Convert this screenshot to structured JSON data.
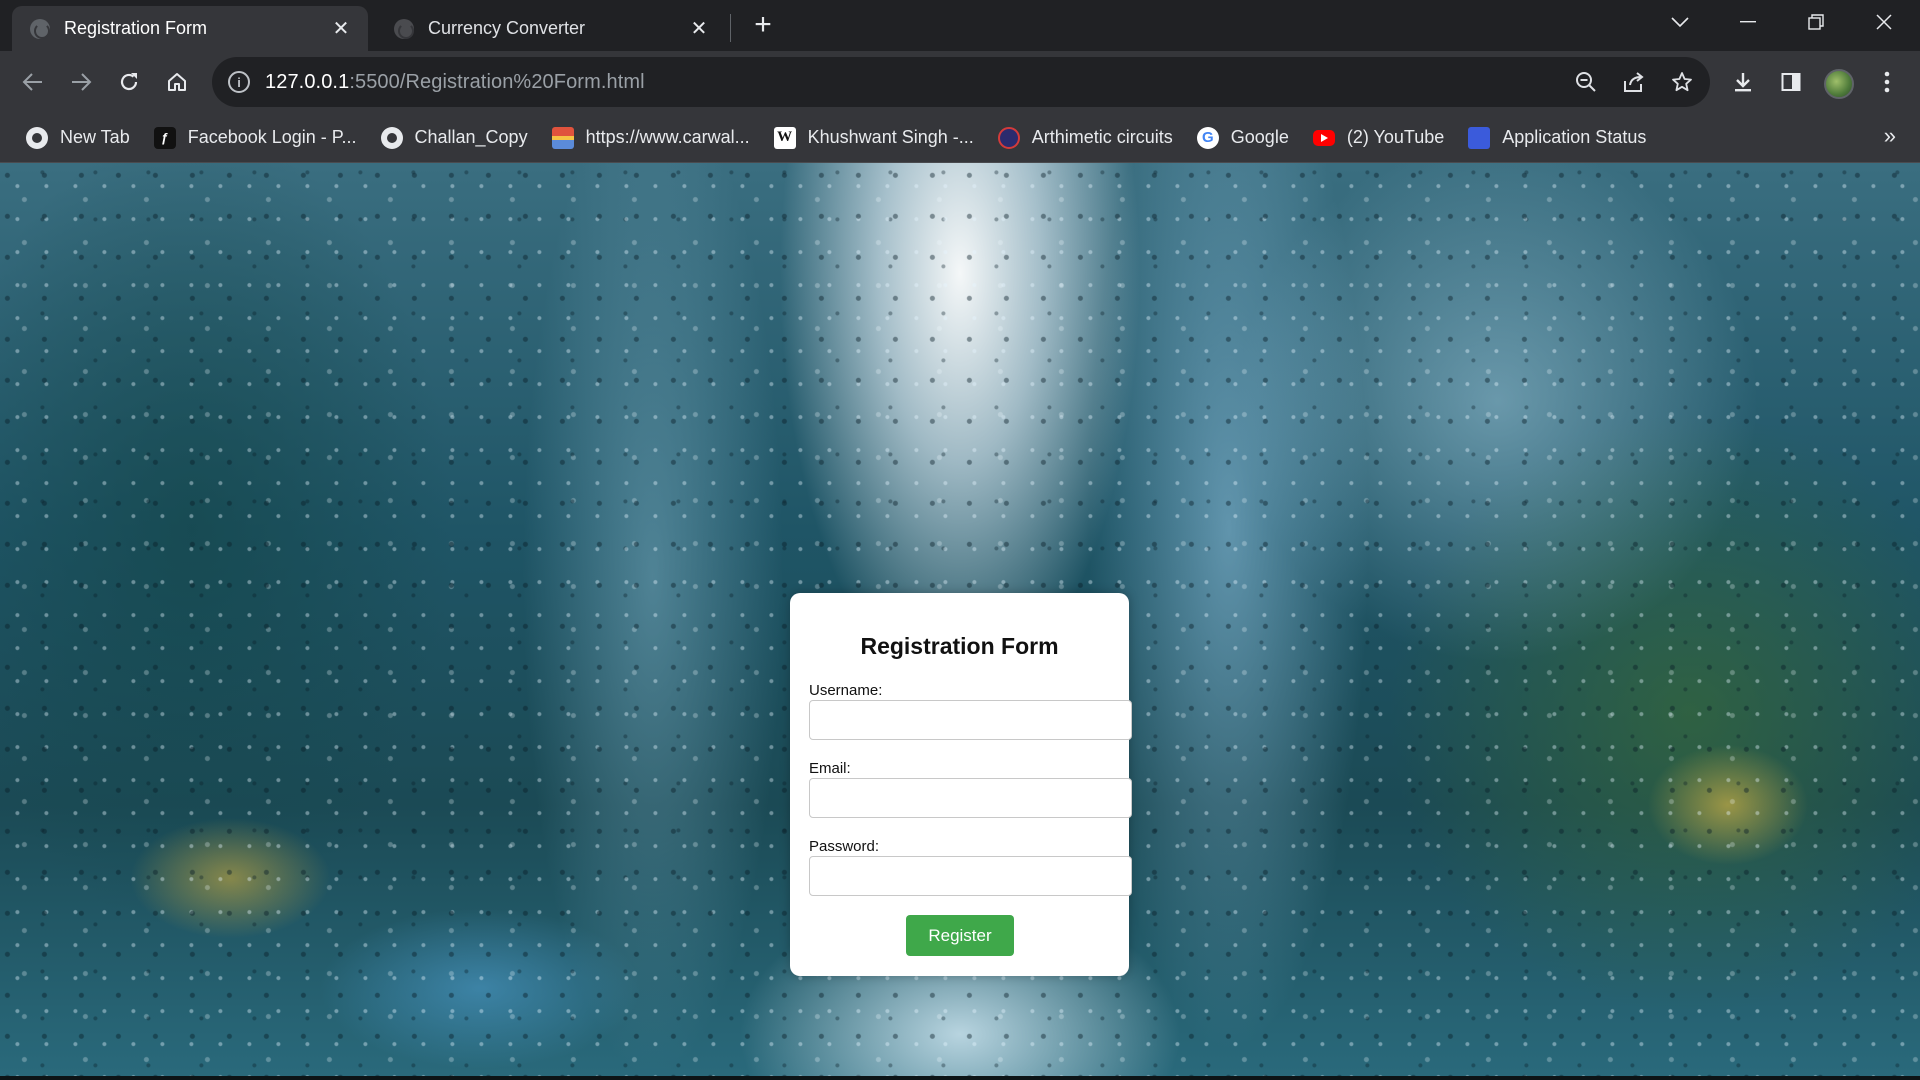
{
  "browser": {
    "tabs": [
      {
        "title": "Registration Form",
        "active": true
      },
      {
        "title": "Currency Converter",
        "active": false
      }
    ],
    "new_tab_symbol": "+",
    "url": {
      "host": "127.0.0.1",
      "path": ":5500/Registration%20Form.html"
    },
    "bookmarks": [
      {
        "label": "New Tab",
        "icon": "globe-icon",
        "color": "#e8eaed"
      },
      {
        "label": "Facebook Login - P...",
        "icon": "facebook-login-icon",
        "color": "#111111"
      },
      {
        "label": "Challan_Copy",
        "icon": "globe-icon",
        "color": "#e8eaed"
      },
      {
        "label": "https://www.carwal...",
        "icon": "carwale-icon",
        "color": "#e0533d"
      },
      {
        "label": "Khushwant Singh -...",
        "icon": "wikipedia-icon",
        "color": "#ffffff"
      },
      {
        "label": "Arthimetic circuits",
        "icon": "channel-icon",
        "color": "#d33b3b"
      },
      {
        "label": "Google",
        "icon": "google-icon",
        "color": "#ffffff"
      },
      {
        "label": "(2) YouTube",
        "icon": "youtube-icon",
        "color": "#ff0000"
      },
      {
        "label": "Application Status",
        "icon": "application-status-icon",
        "color": "#3b5bdb"
      }
    ]
  },
  "form": {
    "title": "Registration Form",
    "username_label": "Username:",
    "username_value": "",
    "email_label": "Email:",
    "email_value": "",
    "password_label": "Password:",
    "password_value": "",
    "submit_label": "Register",
    "accent_color": "#3fa84a"
  }
}
